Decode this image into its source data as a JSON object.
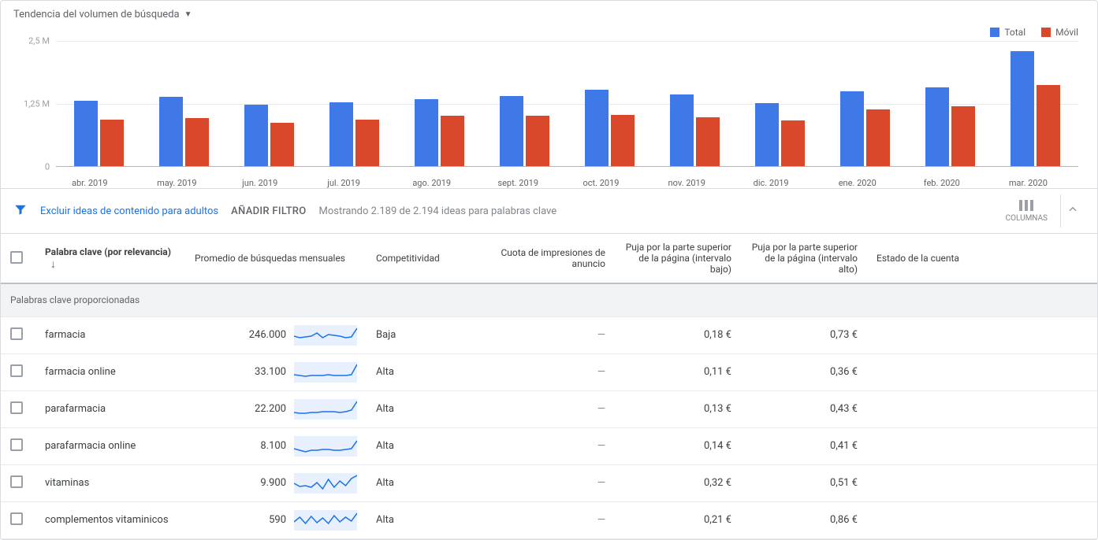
{
  "chart": {
    "title": "Tendencia del volumen de búsqueda",
    "legend": {
      "total": "Total",
      "mobile": "Móvil"
    },
    "yaxis": [
      "2,5 M",
      "1,25 M",
      "0"
    ],
    "categories": [
      "abr. 2019",
      "may. 2019",
      "jun. 2019",
      "jul. 2019",
      "ago. 2019",
      "sept. 2019",
      "oct. 2019",
      "nov. 2019",
      "dic. 2019",
      "ene. 2020",
      "feb. 2020",
      "mar. 2020"
    ]
  },
  "chart_data": {
    "type": "bar",
    "title": "Tendencia del volumen de búsqueda",
    "ylabel": "",
    "ylim": [
      0,
      2500000
    ],
    "categories": [
      "abr. 2019",
      "may. 2019",
      "jun. 2019",
      "jul. 2019",
      "ago. 2019",
      "sept. 2019",
      "oct. 2019",
      "nov. 2019",
      "dic. 2019",
      "ene. 2020",
      "feb. 2020",
      "mar. 2020"
    ],
    "series": [
      {
        "name": "Total",
        "color": "#3f79e8",
        "values": [
          1300000,
          1380000,
          1230000,
          1270000,
          1330000,
          1400000,
          1520000,
          1430000,
          1260000,
          1500000,
          1570000,
          2300000
        ]
      },
      {
        "name": "Móvil",
        "color": "#d9482b",
        "values": [
          930000,
          960000,
          870000,
          930000,
          1010000,
          1000000,
          1020000,
          970000,
          920000,
          1130000,
          1190000,
          1620000
        ]
      }
    ]
  },
  "filters": {
    "exclude_adult": "Excluir ideas de contenido para adultos",
    "add_filter": "AÑADIR FILTRO",
    "showing": "Mostrando 2.189 de 2.194 ideas para palabras clave",
    "columns_label": "COLUMNAS"
  },
  "table": {
    "headers": {
      "keyword": "Palabra clave (por relevancia)",
      "avg": "Promedio de búsquedas mensuales",
      "competition": "Competitividad",
      "impression_share": "Cuota de impresiones de anuncio",
      "low_bid": "Puja por la parte superior de la página (intervalo bajo)",
      "high_bid": "Puja por la parte superior de la página (intervalo alto)",
      "account_status": "Estado de la cuenta"
    },
    "section": "Palabras clave proporcionadas",
    "rows": [
      {
        "keyword": "farmacia",
        "avg": "246.000",
        "competition": "Baja",
        "impression": "—",
        "low": "0,18 €",
        "high": "0,73 €",
        "spark": [
          14,
          16,
          15,
          14,
          10,
          16,
          12,
          13,
          14,
          16,
          15,
          4
        ]
      },
      {
        "keyword": "farmacia online",
        "avg": "33.100",
        "competition": "Alta",
        "impression": "—",
        "low": "0,11 €",
        "high": "0,36 €",
        "spark": [
          16,
          17,
          18,
          17,
          17,
          17,
          16,
          17,
          17,
          17,
          16,
          3
        ]
      },
      {
        "keyword": "parafarmacia",
        "avg": "22.200",
        "competition": "Alta",
        "impression": "—",
        "low": "0,13 €",
        "high": "0,43 €",
        "spark": [
          17,
          18,
          18,
          17,
          17,
          16,
          16,
          16,
          17,
          16,
          14,
          3
        ]
      },
      {
        "keyword": "parafarmacia online",
        "avg": "8.100",
        "competition": "Alta",
        "impression": "—",
        "low": "0,14 €",
        "high": "0,41 €",
        "spark": [
          16,
          18,
          20,
          18,
          18,
          17,
          17,
          18,
          18,
          17,
          16,
          6
        ]
      },
      {
        "keyword": "vitaminas",
        "avg": "9.900",
        "competition": "Alta",
        "impression": "—",
        "low": "0,32 €",
        "high": "0,51 €",
        "spark": [
          13,
          17,
          16,
          18,
          12,
          20,
          8,
          18,
          10,
          16,
          7,
          3
        ]
      },
      {
        "keyword": "complementos vitaminicos",
        "avg": "590",
        "competition": "Alta",
        "impression": "—",
        "low": "0,21 €",
        "high": "0,86 €",
        "spark": [
          15,
          9,
          17,
          8,
          16,
          10,
          17,
          7,
          15,
          9,
          14,
          4
        ]
      }
    ]
  }
}
